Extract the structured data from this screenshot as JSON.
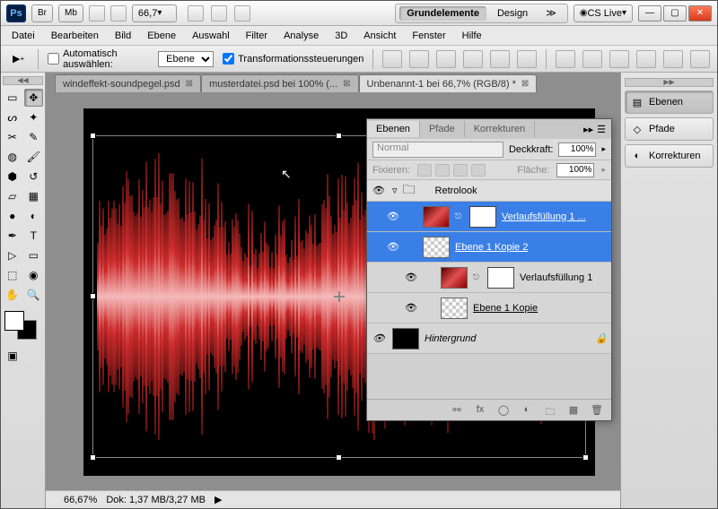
{
  "titlebar": {
    "zoom_dd": "66,7",
    "workspace": {
      "essentials": "Grundelemente",
      "design": "Design"
    },
    "cslive": "CS Live"
  },
  "menu": [
    "Datei",
    "Bearbeiten",
    "Bild",
    "Ebene",
    "Auswahl",
    "Filter",
    "Analyse",
    "3D",
    "Ansicht",
    "Fenster",
    "Hilfe"
  ],
  "optbar": {
    "auto_select_label": "Automatisch auswählen:",
    "auto_select_mode": "Ebene",
    "transform_label": "Transformationssteuerungen"
  },
  "tabs": [
    {
      "label": "windeffekt-soundpegel.psd",
      "active": false
    },
    {
      "label": "musterdatei.psd bei 100% (...",
      "active": false
    },
    {
      "label": "Unbenannt-1 bei 66,7% (RGB/8) *",
      "active": true
    }
  ],
  "layers_panel": {
    "tabs": [
      "Ebenen",
      "Pfade",
      "Korrekturen"
    ],
    "blend_mode": "Normal",
    "opacity_label": "Deckkraft:",
    "opacity": "100%",
    "fill_label": "Fläche:",
    "fill": "100%",
    "lock_label": "Fixieren:",
    "group": "Retrolook",
    "layers": [
      {
        "name": "Verlaufsfüllung 1 ...",
        "selected": true,
        "fill": true
      },
      {
        "name": "Ebene 1 Kopie 2",
        "selected": true,
        "fill": false
      },
      {
        "name": "Verlaufsfüllung 1",
        "selected": false,
        "fill": true
      },
      {
        "name": "Ebene 1 Kopie",
        "selected": false,
        "fill": false
      }
    ],
    "background": "Hintergrund"
  },
  "dock": {
    "ebenen": "Ebenen",
    "pfade": "Pfade",
    "korrekturen": "Korrekturen"
  },
  "status": {
    "zoom": "66,67%",
    "doc": "Dok: 1,37 MB/3,27 MB"
  }
}
